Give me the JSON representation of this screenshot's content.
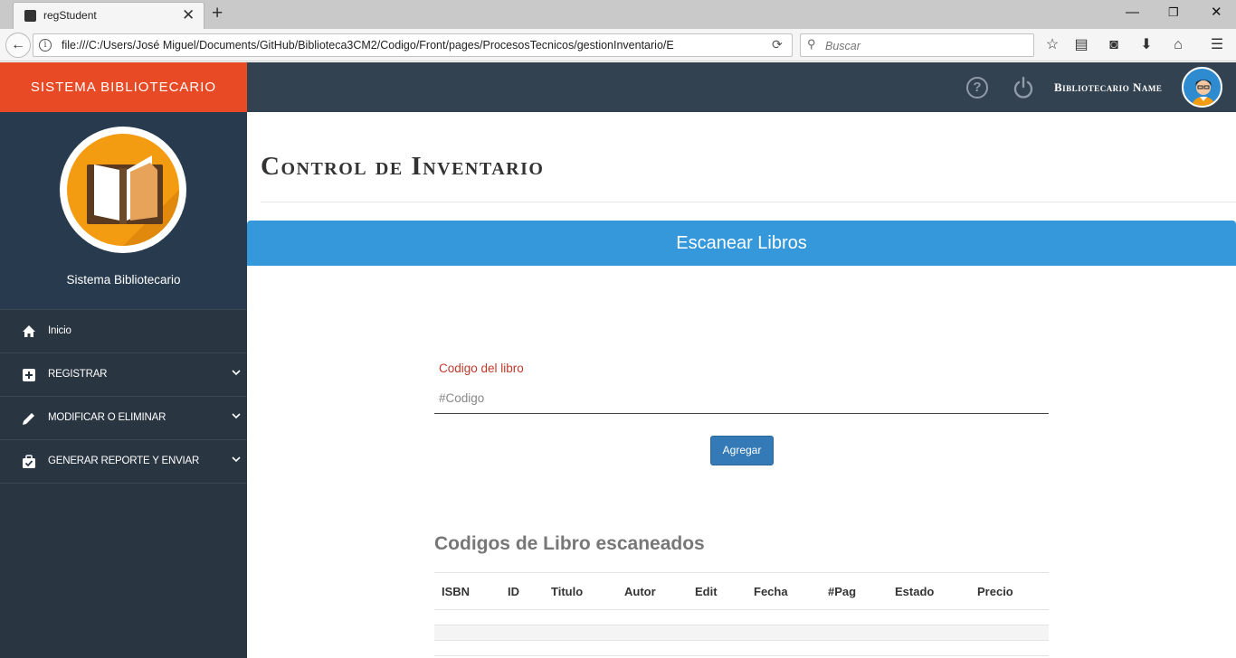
{
  "browser": {
    "tab_title": "regStudent",
    "url": "file:///C:/Users/José Miguel/Documents/GitHub/Biblioteca3CM2/Codigo/Front/pages/ProcesosTecnicos/gestionInventario/E",
    "search_placeholder": "Buscar"
  },
  "header": {
    "brand": "SISTEMA BIBLIOTECARIO",
    "user_name": "Bibliotecario Name"
  },
  "sidebar": {
    "profile_name": "Sistema Bibliotecario",
    "items": [
      {
        "label": "Inicio",
        "icon": "home-icon"
      },
      {
        "label": "REGISTRAR",
        "icon": "plus-square-icon"
      },
      {
        "label": "MODIFICAR O ELIMINAR",
        "icon": "pencil-icon"
      },
      {
        "label": "GENERAR REPORTE Y ENVIAR",
        "icon": "briefcase-check-icon"
      }
    ]
  },
  "main": {
    "page_title": "Control de Inventario",
    "scan_header": "Escanear Libros",
    "field_label": "Codigo del libro",
    "field_placeholder": "#Codigo",
    "add_button": "Agregar",
    "scanned_title": "Codigos de Libro escaneados",
    "table_headers": [
      "ISBN",
      "ID",
      "Titulo",
      "Autor",
      "Edit",
      "Fecha",
      "#Pag",
      "Estado",
      "Precio"
    ]
  },
  "colors": {
    "brand": "#e84a26",
    "topbar": "#334251",
    "sidebar": "#2a3542",
    "accent_blue": "#3498db",
    "label_red": "#c0392b"
  }
}
